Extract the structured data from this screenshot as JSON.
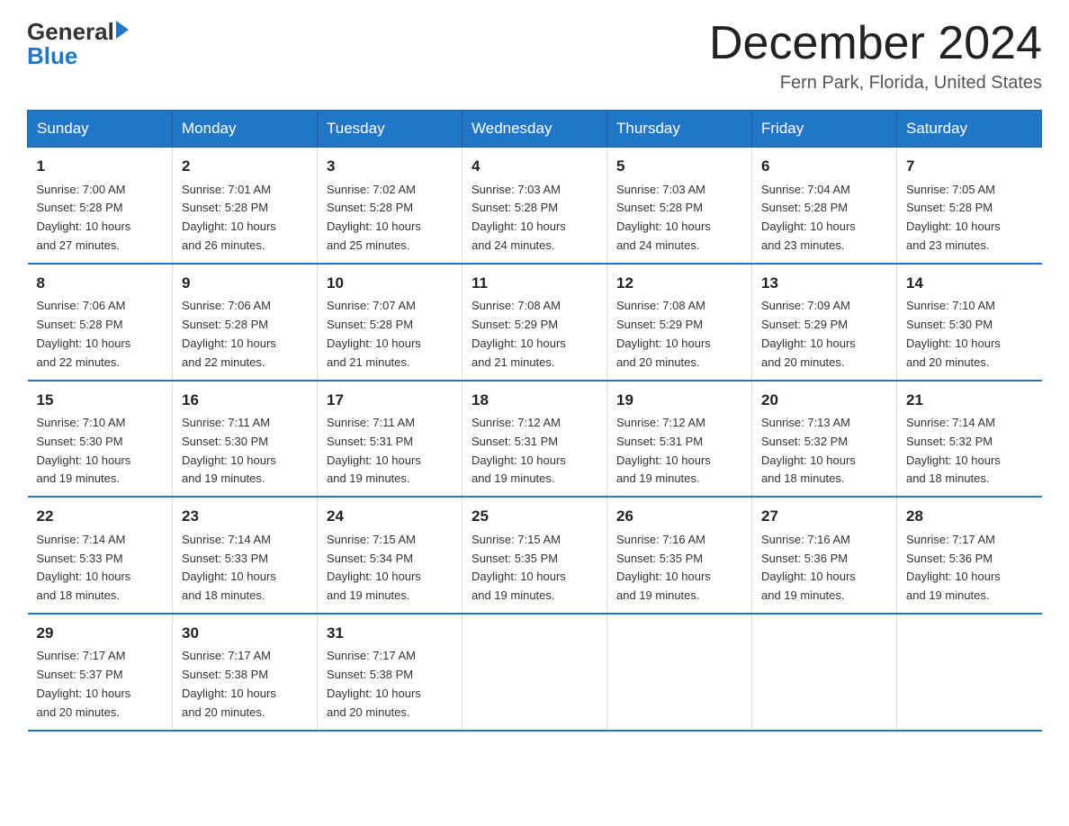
{
  "logo": {
    "text_general": "General",
    "text_blue": "Blue",
    "line1": "General",
    "line2": "Blue"
  },
  "header": {
    "month_title": "December 2024",
    "location": "Fern Park, Florida, United States"
  },
  "days_of_week": [
    "Sunday",
    "Monday",
    "Tuesday",
    "Wednesday",
    "Thursday",
    "Friday",
    "Saturday"
  ],
  "weeks": [
    [
      {
        "day": "1",
        "sunrise": "7:00 AM",
        "sunset": "5:28 PM",
        "daylight": "10 hours and 27 minutes."
      },
      {
        "day": "2",
        "sunrise": "7:01 AM",
        "sunset": "5:28 PM",
        "daylight": "10 hours and 26 minutes."
      },
      {
        "day": "3",
        "sunrise": "7:02 AM",
        "sunset": "5:28 PM",
        "daylight": "10 hours and 25 minutes."
      },
      {
        "day": "4",
        "sunrise": "7:03 AM",
        "sunset": "5:28 PM",
        "daylight": "10 hours and 24 minutes."
      },
      {
        "day": "5",
        "sunrise": "7:03 AM",
        "sunset": "5:28 PM",
        "daylight": "10 hours and 24 minutes."
      },
      {
        "day": "6",
        "sunrise": "7:04 AM",
        "sunset": "5:28 PM",
        "daylight": "10 hours and 23 minutes."
      },
      {
        "day": "7",
        "sunrise": "7:05 AM",
        "sunset": "5:28 PM",
        "daylight": "10 hours and 23 minutes."
      }
    ],
    [
      {
        "day": "8",
        "sunrise": "7:06 AM",
        "sunset": "5:28 PM",
        "daylight": "10 hours and 22 minutes."
      },
      {
        "day": "9",
        "sunrise": "7:06 AM",
        "sunset": "5:28 PM",
        "daylight": "10 hours and 22 minutes."
      },
      {
        "day": "10",
        "sunrise": "7:07 AM",
        "sunset": "5:28 PM",
        "daylight": "10 hours and 21 minutes."
      },
      {
        "day": "11",
        "sunrise": "7:08 AM",
        "sunset": "5:29 PM",
        "daylight": "10 hours and 21 minutes."
      },
      {
        "day": "12",
        "sunrise": "7:08 AM",
        "sunset": "5:29 PM",
        "daylight": "10 hours and 20 minutes."
      },
      {
        "day": "13",
        "sunrise": "7:09 AM",
        "sunset": "5:29 PM",
        "daylight": "10 hours and 20 minutes."
      },
      {
        "day": "14",
        "sunrise": "7:10 AM",
        "sunset": "5:30 PM",
        "daylight": "10 hours and 20 minutes."
      }
    ],
    [
      {
        "day": "15",
        "sunrise": "7:10 AM",
        "sunset": "5:30 PM",
        "daylight": "10 hours and 19 minutes."
      },
      {
        "day": "16",
        "sunrise": "7:11 AM",
        "sunset": "5:30 PM",
        "daylight": "10 hours and 19 minutes."
      },
      {
        "day": "17",
        "sunrise": "7:11 AM",
        "sunset": "5:31 PM",
        "daylight": "10 hours and 19 minutes."
      },
      {
        "day": "18",
        "sunrise": "7:12 AM",
        "sunset": "5:31 PM",
        "daylight": "10 hours and 19 minutes."
      },
      {
        "day": "19",
        "sunrise": "7:12 AM",
        "sunset": "5:31 PM",
        "daylight": "10 hours and 19 minutes."
      },
      {
        "day": "20",
        "sunrise": "7:13 AM",
        "sunset": "5:32 PM",
        "daylight": "10 hours and 18 minutes."
      },
      {
        "day": "21",
        "sunrise": "7:14 AM",
        "sunset": "5:32 PM",
        "daylight": "10 hours and 18 minutes."
      }
    ],
    [
      {
        "day": "22",
        "sunrise": "7:14 AM",
        "sunset": "5:33 PM",
        "daylight": "10 hours and 18 minutes."
      },
      {
        "day": "23",
        "sunrise": "7:14 AM",
        "sunset": "5:33 PM",
        "daylight": "10 hours and 18 minutes."
      },
      {
        "day": "24",
        "sunrise": "7:15 AM",
        "sunset": "5:34 PM",
        "daylight": "10 hours and 19 minutes."
      },
      {
        "day": "25",
        "sunrise": "7:15 AM",
        "sunset": "5:35 PM",
        "daylight": "10 hours and 19 minutes."
      },
      {
        "day": "26",
        "sunrise": "7:16 AM",
        "sunset": "5:35 PM",
        "daylight": "10 hours and 19 minutes."
      },
      {
        "day": "27",
        "sunrise": "7:16 AM",
        "sunset": "5:36 PM",
        "daylight": "10 hours and 19 minutes."
      },
      {
        "day": "28",
        "sunrise": "7:17 AM",
        "sunset": "5:36 PM",
        "daylight": "10 hours and 19 minutes."
      }
    ],
    [
      {
        "day": "29",
        "sunrise": "7:17 AM",
        "sunset": "5:37 PM",
        "daylight": "10 hours and 20 minutes."
      },
      {
        "day": "30",
        "sunrise": "7:17 AM",
        "sunset": "5:38 PM",
        "daylight": "10 hours and 20 minutes."
      },
      {
        "day": "31",
        "sunrise": "7:17 AM",
        "sunset": "5:38 PM",
        "daylight": "10 hours and 20 minutes."
      },
      null,
      null,
      null,
      null
    ]
  ],
  "labels": {
    "sunrise": "Sunrise:",
    "sunset": "Sunset:",
    "daylight": "Daylight:"
  }
}
